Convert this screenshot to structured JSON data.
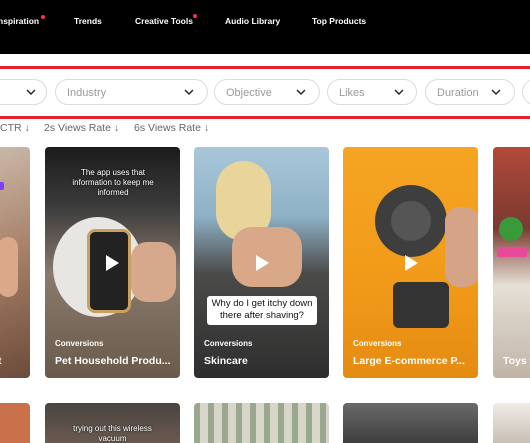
{
  "nav": {
    "items": [
      {
        "label": "nspiration",
        "has_dot": true
      },
      {
        "label": "Trends",
        "has_dot": false
      },
      {
        "label": "Creative Tools",
        "has_dot": true
      },
      {
        "label": "Audio Library",
        "has_dot": false
      },
      {
        "label": "Top Products",
        "has_dot": false
      }
    ],
    "dot_color": "#fe2c55"
  },
  "filters": [
    {
      "label": ""
    },
    {
      "label": "Industry"
    },
    {
      "label": "Objective"
    },
    {
      "label": "Likes"
    },
    {
      "label": "Duration"
    }
  ],
  "sort": [
    {
      "label": "CTR"
    },
    {
      "label": "2s Views Rate"
    },
    {
      "label": "6s Views Rate"
    }
  ],
  "cards": [
    {
      "tag": "",
      "title": "t"
    },
    {
      "tag": "Conversions",
      "title": "Pet Household Produ...",
      "overlay": "The app uses that information to keep me informed"
    },
    {
      "tag": "Conversions",
      "title": "Skincare",
      "caption": "Why do I get itchy down there after shaving?"
    },
    {
      "tag": "Conversions",
      "title": "Large E-commerce P..."
    },
    {
      "tag": "",
      "title": "Toys t"
    }
  ],
  "row2": {
    "overlay": "trying out this wireless vacuum"
  },
  "colors": {
    "accent": "#e5202f",
    "brand": "#fe2c55"
  }
}
